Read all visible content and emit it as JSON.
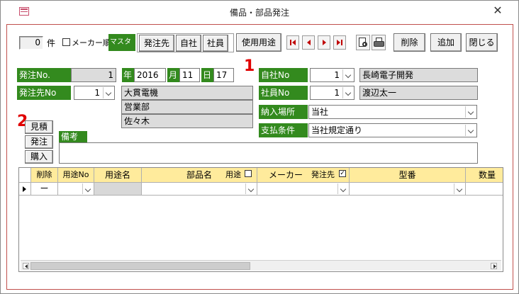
{
  "window": {
    "title": "備品・部品発注",
    "close": "✕"
  },
  "colors": {
    "green": "#338a1e",
    "header_yellow": "#ffeb9c",
    "red": "#e00000"
  },
  "toolbar": {
    "count_value": "0",
    "count_label": "件",
    "maker_order_label": "メーカー順",
    "master_label": "マスター",
    "btn_order_dest": "発注先",
    "btn_company": "自社",
    "btn_employee": "社員",
    "btn_usage": "使用用途",
    "btn_delete": "削除",
    "btn_add": "追加",
    "btn_close": "閉じる"
  },
  "header": {
    "order_no_label": "発注No.",
    "order_no_value": "1",
    "year_label": "年",
    "year_value": "2016",
    "month_label": "月",
    "month_value": "11",
    "day_label": "日",
    "day_value": "17",
    "supplier_no_label": "発注先No",
    "supplier_no_value": "1",
    "supplier_name": "大貫電機",
    "supplier_dept": "営業部",
    "supplier_person": "佐々木",
    "company_no_label": "自社No",
    "company_no_value": "1",
    "company_name": "長崎電子開発",
    "employee_no_label": "社員No",
    "employee_no_value": "1",
    "employee_name": "渡辺太一",
    "delivery_label": "納入場所",
    "delivery_value": "当社",
    "payment_label": "支払条件",
    "payment_value": "当社規定通り",
    "remarks_label": "備考"
  },
  "annotations": {
    "one": "1",
    "two": "2"
  },
  "side_buttons": {
    "estimate": "見積",
    "order": "発注",
    "purchase": "購入"
  },
  "grid": {
    "columns": {
      "delete": "削除",
      "usage_no": "用途No",
      "usage_name": "用途名",
      "part_name": "部品名",
      "usage_flag": "用途",
      "maker": "メーカー",
      "supplier_flag": "発注先",
      "model": "型番",
      "quantity": "数量"
    },
    "rows": [
      {
        "delete": "ー"
      }
    ]
  }
}
